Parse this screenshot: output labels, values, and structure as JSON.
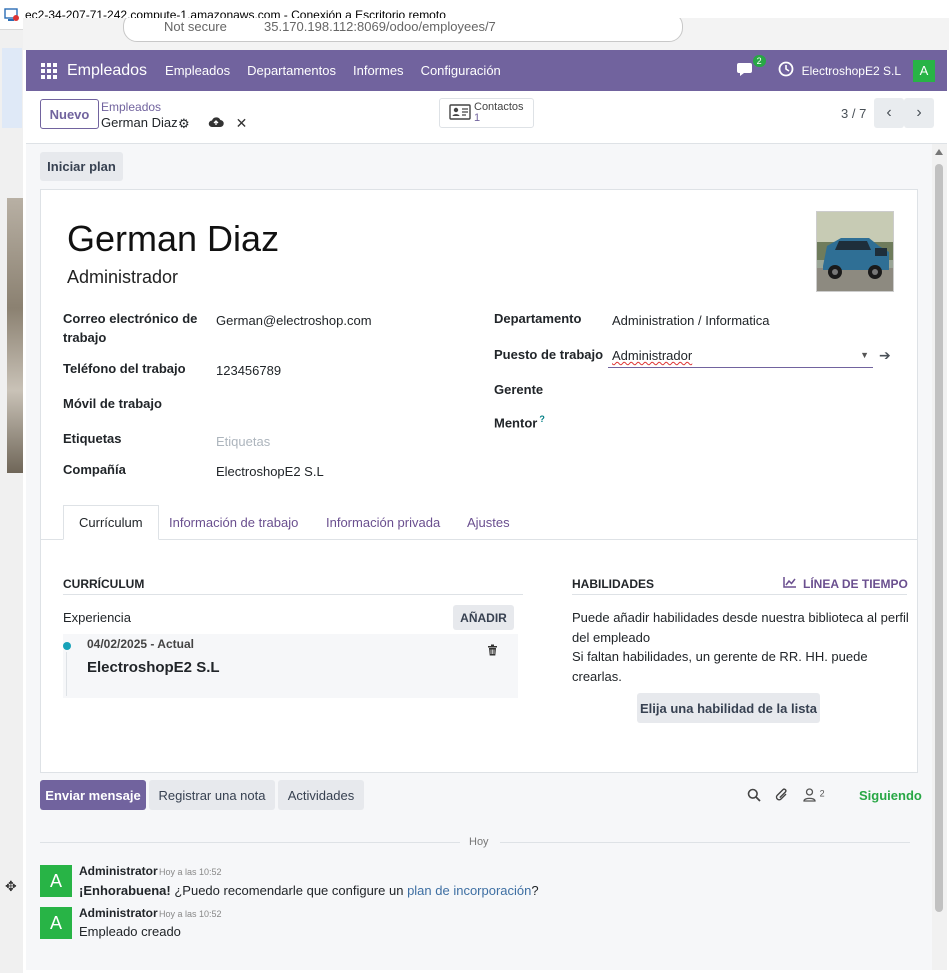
{
  "rdp": {
    "title": "ec2-34-207-71-242.compute-1.amazonaws.com - Conexión a Escritorio remoto"
  },
  "browser": {
    "security": "Not secure",
    "url": "35.170.198.112:8069/odoo/employees/7"
  },
  "navbar": {
    "brand": "Empleados",
    "menu": [
      "Empleados",
      "Departamentos",
      "Informes",
      "Configuración"
    ],
    "chat_badge": "2",
    "company": "ElectroshopE2 S.L",
    "avatar_letter": "A",
    "accent_color": "#71639e"
  },
  "control": {
    "new_label": "Nuevo",
    "breadcrumb_parent": "Empleados",
    "breadcrumb_current": "German Diaz",
    "contacts_label": "Contactos",
    "contacts_count": "1",
    "pager": "3 / 7"
  },
  "actions": {
    "start_plan": "Iniciar plan"
  },
  "employee": {
    "name": "German Diaz",
    "job_title": "Administrador",
    "photo_icon": "car-photo"
  },
  "fields": {
    "work_email_label": "Correo electrónico de trabajo",
    "work_email": "German@electroshop.com",
    "work_phone_label": "Teléfono del trabajo",
    "work_phone": "123456789",
    "mobile_label": "Móvil de trabajo",
    "tags_label": "Etiquetas",
    "tags_placeholder": "Etiquetas",
    "company_label": "Compañía",
    "company": "ElectroshopE2 S.L",
    "department_label": "Departamento",
    "department": "Administration / Informatica",
    "job_position_label": "Puesto de trabajo",
    "job_position": "Administrador",
    "manager_label": "Gerente",
    "mentor_label": "Mentor",
    "mentor_help": "?"
  },
  "tabs": [
    "Currículum",
    "Información de trabajo",
    "Información privada",
    "Ajustes"
  ],
  "resume": {
    "section_title": "CURRÍCULUM",
    "experience_label": "Experiencia",
    "add_label": "AÑADIR",
    "line_date": "04/02/2025 - Actual",
    "line_title": "ElectroshopE2 S.L"
  },
  "skills": {
    "section_title": "HABILIDADES",
    "timeline_label": "LÍNEA DE TIEMPO",
    "line1": "Puede añadir habilidades desde nuestra biblioteca al perfil del empleado",
    "line2": "Si faltan habilidades, un gerente de RR. HH. puede crearlas.",
    "pick_label": "Elija una habilidad de la lista"
  },
  "chatter": {
    "send_label": "Enviar mensaje",
    "note_label": "Registrar una nota",
    "activities_label": "Actividades",
    "followers_count": "2",
    "following_label": "Siguiendo",
    "today_label": "Hoy",
    "messages": [
      {
        "avatar": "A",
        "author": "Administrator",
        "time": "Hoy a las 10:52",
        "bold": "¡Enhorabuena!",
        "text": " ¿Puedo recomendarle que configure un ",
        "link": "plan de incorporación",
        "suffix": "?"
      },
      {
        "avatar": "A",
        "author": "Administrator",
        "time": "Hoy a las 10:52",
        "text": "Empleado creado"
      }
    ]
  }
}
